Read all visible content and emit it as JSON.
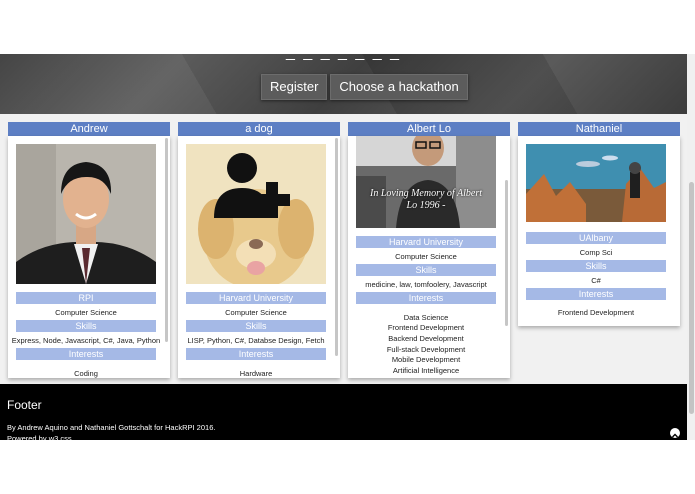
{
  "hero": {
    "title_fragment": "_ _ _ _ _ _ _",
    "register_label": "Register",
    "choose_label": "Choose a hackathon"
  },
  "cards": [
    {
      "name": "Andrew",
      "school": "RPI",
      "major": "Computer Science",
      "skills_heading": "Skills",
      "skills": "Express, Node, Javascript, C#, Java, Python",
      "interests_heading": "Interests",
      "interests": [
        "Coding"
      ]
    },
    {
      "name": "a dog",
      "school": "Harvard University",
      "major": "Computer Science",
      "skills_heading": "Skills",
      "skills": "LISP, Python, C#, Databse Design, Fetch",
      "interests_heading": "Interests",
      "interests": [
        "Hardware"
      ]
    },
    {
      "name": "Albert Lo",
      "photo_caption": "In Loving Memory of Albert Lo 1996 -",
      "school": "Harvard University",
      "major": "Computer Science",
      "skills_heading": "Skills",
      "skills": "medicine, law, tomfoolery, Javascript",
      "interests_heading": "Interests",
      "interests": [
        "Data Science",
        "Frontend Development",
        "Backend Development",
        "Full-stack Development",
        "Mobile Development",
        "Artificial Intelligence"
      ]
    },
    {
      "name": "Nathaniel",
      "school": "UAlbany",
      "major": "Comp Sci",
      "skills_heading": "Skills",
      "skills": "C#",
      "interests_heading": "Interests",
      "interests": [
        "Frontend Development"
      ]
    }
  ],
  "footer": {
    "title": "Footer",
    "credit": "By Andrew Aquino and Nathaniel Gottschalt for HackRPI 2016.",
    "powered": "Powered by w3.css"
  },
  "colors": {
    "card_header": "#5d7fc4",
    "section_bar": "#a5b9e6",
    "footer_bg": "#000000",
    "hero_bg": "#474747"
  },
  "icons": [
    "add-user-icon",
    "arrow-up-icon"
  ]
}
